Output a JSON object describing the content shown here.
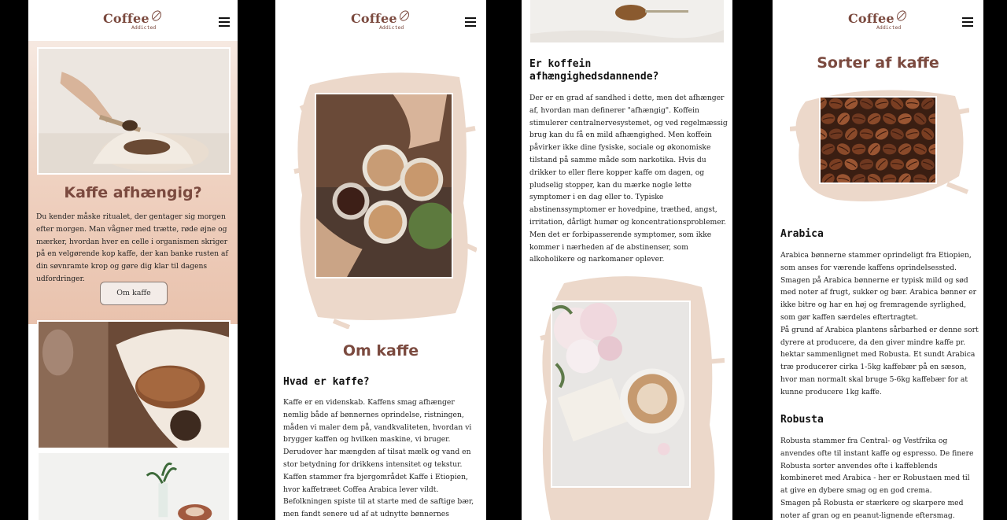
{
  "logo": {
    "main": "Coffee",
    "sub": "Addicted"
  },
  "screen1": {
    "title": "Kaffe afhængig?",
    "intro": "Du kender måske ritualet, der gentager sig morgen efter morgen. Man vågner med trætte, røde øjne og mærker, hvordan hver en celle i organismen skriger på en velgørende kop kaffe, der kan banke rusten af din søvnramte krop og gøre dig klar til dagens udfordringer.",
    "button": "Om kaffe"
  },
  "screen2": {
    "title": "Om kaffe",
    "subtitle": "Hvad er kaffe?",
    "para1": "Kaffe er en videnskab. Kaffens smag afhænger nemlig både af bønnernes oprindelse, ristningen, måden vi maler dem på, vandkvaliteten, hvordan vi brygger kaffen og hvilken maskine, vi bruger. Derudover har mængden af tilsat mælk og vand en stor betydning for drikkens intensitet og tekstur.",
    "para2": "Kaffen stammer fra bjergområdet Kaffe i Etiopien, hvor kaffetræet Coffea Arabica lever vildt. Befolkningen spiste til at starte med de saftige bær, men fandt senere ud af at udnytte bønnernes aromatiske smag."
  },
  "screen3": {
    "title": "Er koffein afhængighedsdannende?",
    "para": "Der er en grad af sandhed i dette, men det afhænger af, hvordan man definerer \"afhængig\". Koffein stimulerer centralnervesystemet, og ved regelmæssig brug kan du få en mild afhængighed. Men koffein påvirker ikke dine fysiske, sociale og økonomiske tilstand på samme måde som narkotika. Hvis du drikker to eller flere kopper kaffe om dagen, og pludselig stopper, kan du mærke nogle lette symptomer i en dag eller to. Typiske abstinenssymptomer er hovedpine, træthed, angst, irritation, dårligt humør og koncentrationsproblemer. Men det er forbipasserende symptomer, som ikke kommer i nærheden af de abstinenser, som alkoholikere og narkomaner oplever."
  },
  "screen4": {
    "title": "Sorter af kaffe",
    "arabica_title": "Arabica",
    "arabica_p1": "Arabica bønnerne stammer oprindeligt fra Etiopien, som anses for værende kaffens oprindelsessted. Smagen på Arabica bønnerne er typisk mild og sød med noter af frugt, sukker og bær. Arabica bønner er ikke bitre og har en høj og fremragende syrlighed, som gør kaffen særdeles eftertragtet.",
    "arabica_p2": "På grund af Arabica plantens sårbarhed er denne sort dyrere at producere, da den giver mindre kaffe pr. hektar sammenlignet med Robusta. Et sundt Arabica træ producerer cirka 1-5kg kaffebær på en sæson, hvor man normalt skal bruge 5-6kg kaffebær for at kunne producere 1kg kaffe.",
    "robusta_title": "Robusta",
    "robusta_p1": "Robusta stammer fra Central- og Vestfrika og anvendes ofte til instant kaffe og espresso. De finere Robusta sorter anvendes ofte i kaffeblends kombineret med Arabica - her er Robustaen med til at give en dybere smag og en god crema.",
    "robusta_p2": "Smagen på Robusta er stærkere og skarpere med noter af gran og en peanut-lignende eftersmag. Bønnerne"
  },
  "icons": {
    "menu": "hamburger-icon",
    "logo_bean": "coffee-bean-icon"
  },
  "colors": {
    "brand_brown": "#7b4a3f",
    "peach": "#eecbb8",
    "paint_beige": "#e9d3c4"
  }
}
